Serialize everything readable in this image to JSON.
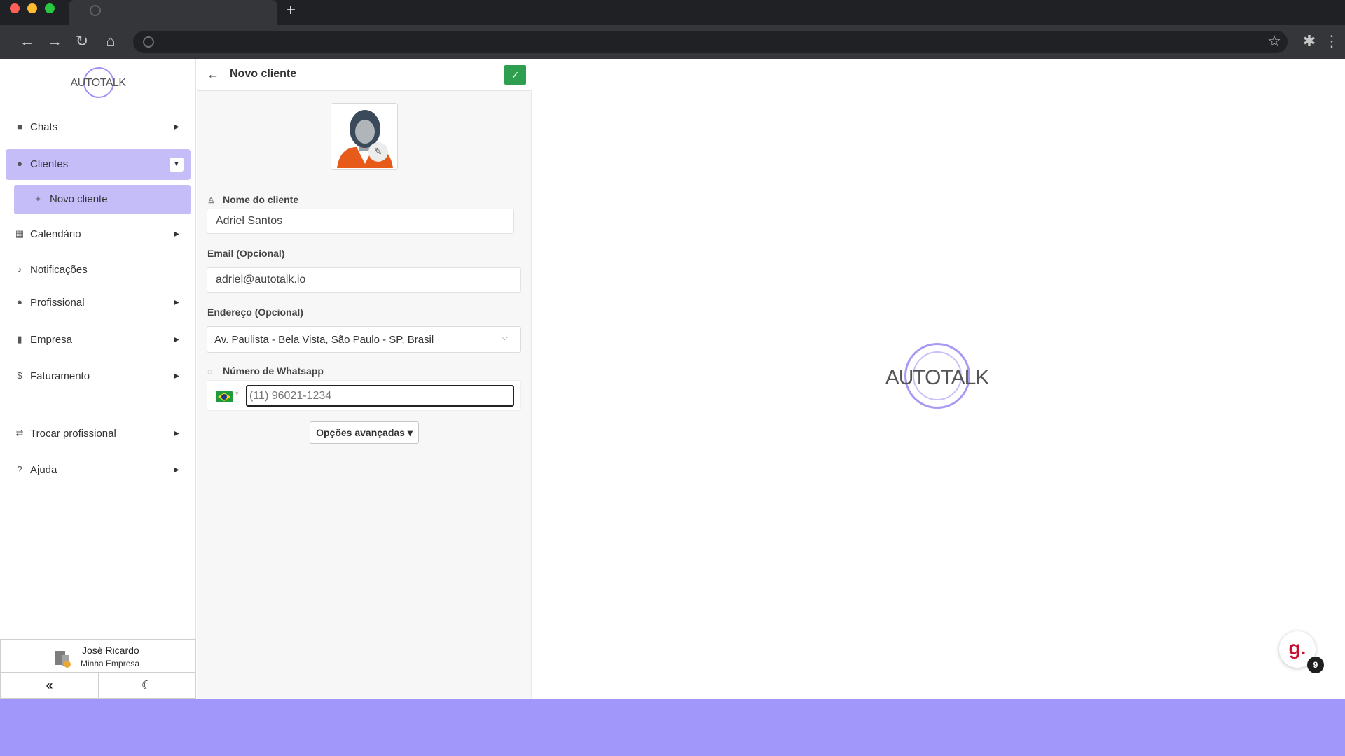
{
  "browser": {
    "new_tab": "+",
    "nav_icons": {
      "back": "←",
      "forward": "→",
      "reload": "↻",
      "home": "⌂"
    },
    "right_icons": {
      "bookmark": "☆",
      "extensions": "✱",
      "menu": "⋮"
    }
  },
  "sidebar": {
    "logo": "AUTOTALK",
    "items": [
      {
        "label": "Chats",
        "icon": "chat-icon",
        "glyph": "■",
        "arrow": "▶"
      },
      {
        "label": "Clientes",
        "icon": "users-icon",
        "glyph": "●",
        "arrow": "▼"
      },
      {
        "label": "Calendário",
        "icon": "calendar-icon",
        "glyph": "▦",
        "arrow": "▶"
      },
      {
        "label": "Notificações",
        "icon": "bell-icon",
        "glyph": "♪"
      },
      {
        "label": "Profissional",
        "icon": "professional-icon",
        "glyph": "●",
        "arrow": "▶"
      },
      {
        "label": "Empresa",
        "icon": "building-icon",
        "glyph": "▮",
        "arrow": "▶"
      },
      {
        "label": "Faturamento",
        "icon": "dollar-icon",
        "glyph": "$",
        "arrow": "▶"
      },
      {
        "label": "Trocar profissional",
        "icon": "switch-user-icon",
        "glyph": "⇄",
        "arrow": "▶"
      },
      {
        "label": "Ajuda",
        "icon": "help-icon",
        "glyph": "?",
        "arrow": "▶"
      }
    ],
    "subitem": {
      "label": "Novo cliente",
      "icon": "user-plus-icon",
      "glyph": "+"
    },
    "user": {
      "name": "José Ricardo",
      "company": "Minha Empresa"
    },
    "collapse_glyph": "«",
    "theme_glyph": "☾"
  },
  "form": {
    "title": "Novo cliente",
    "back_glyph": "←",
    "save_glyph": "✓",
    "edit_glyph": "✎",
    "name_label": "Nome do cliente",
    "name_value": "Adriel Santos",
    "email_label": "Email (Opcional)",
    "email_value": "adriel@autotalk.io",
    "address_label": "Endereço (Opcional)",
    "address_value": "Av. Paulista - Bela Vista, São Paulo - SP, Brasil",
    "whatsapp_label": "Número de Whatsapp",
    "phone_placeholder": "(11) 96021-1234",
    "country_flag": "brazil-flag",
    "advanced_label": "Opções avançadas ▾"
  },
  "main": {
    "logo": "AUTOTALK"
  },
  "widget": {
    "letter": "g.",
    "badge": "9"
  },
  "colors": {
    "accent": "#a197fb",
    "active_nav": "#c5bdf7",
    "save_green": "#2e9e4f"
  }
}
